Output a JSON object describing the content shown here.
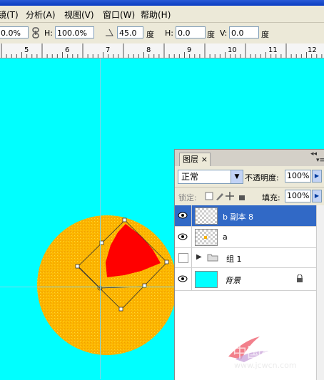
{
  "menu": {
    "items": [
      {
        "label": "镜(T)"
      },
      {
        "label": "分析(A)"
      },
      {
        "label": "视图(V)"
      },
      {
        "label": "窗口(W)"
      },
      {
        "label": "帮助(H)"
      }
    ]
  },
  "options": {
    "w_value": "0.0%",
    "h_label": "H:",
    "h_value": "100.0%",
    "angle_value": "45.0",
    "angle_unit": "度",
    "hskew_label": "H:",
    "hskew_value": "0.0",
    "hskew_unit": "度",
    "vskew_label": "V:",
    "vskew_value": "0.0",
    "vskew_unit": "度"
  },
  "ruler": {
    "ticks": [
      "5",
      "6",
      "7",
      "8",
      "9",
      "10",
      "11",
      "12"
    ]
  },
  "layers_panel": {
    "tab_label": "图层",
    "close_glyph": "×",
    "blend_mode": "正常",
    "opacity_label": "不透明度:",
    "opacity_value": "100%",
    "lock_label": "锁定:",
    "fill_label": "填充:",
    "fill_value": "100%",
    "layers": [
      {
        "name": "b 副本 8",
        "visible": true,
        "selected": true
      },
      {
        "name": "a",
        "visible": true,
        "selected": false
      },
      {
        "name": "组 1",
        "visible": false,
        "selected": false
      },
      {
        "name": "背景",
        "visible": true,
        "selected": false
      }
    ]
  },
  "watermark": {
    "text": "中国教程网",
    "url": "www.jcwcn.com"
  },
  "colors": {
    "canvas": "#00ffff",
    "orb_fill": "#ffc000",
    "wedge": "#ff0000",
    "selection": "#3169c6"
  }
}
